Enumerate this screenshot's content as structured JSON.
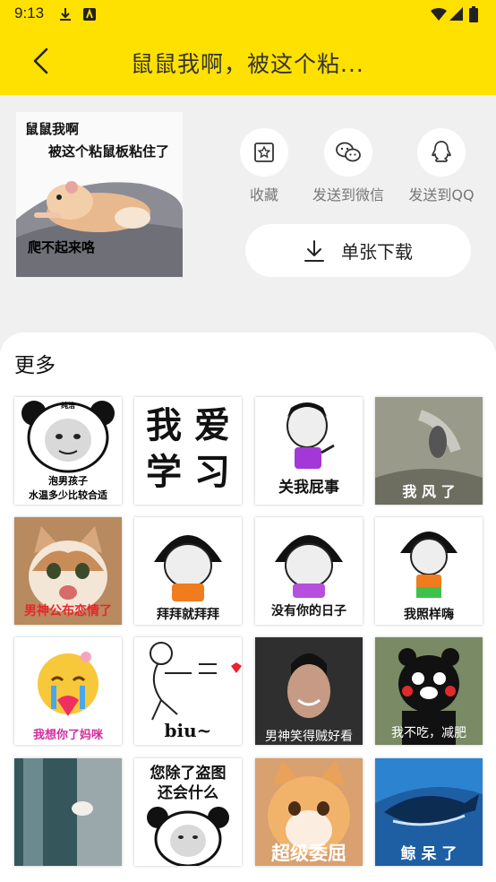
{
  "status": {
    "time": "9:13",
    "icons": [
      "download-icon",
      "app-notification-icon",
      "wifi-icon",
      "signal-icon",
      "battery-icon"
    ]
  },
  "appbar": {
    "title": "鼠鼠我啊，被这个粘...",
    "back_icon": "chevron-left-icon",
    "background_color": "#FFE100"
  },
  "preview": {
    "line1": "鼠鼠我啊",
    "line2": "被这个粘鼠板粘住了",
    "line3": "爬不起来咯"
  },
  "actions": [
    {
      "label": "收藏",
      "icon": "star-bookmark-icon"
    },
    {
      "label": "发送到微信",
      "icon": "wechat-icon"
    },
    {
      "label": "发送到QQ",
      "icon": "qq-icon"
    }
  ],
  "download": {
    "label": "单张下载",
    "icon": "download-icon"
  },
  "more": {
    "title": "更多",
    "tiles": [
      {
        "caption": "泡男孩子\n水温多少比较合适",
        "top_text": "纯洁"
      },
      {
        "caption": "我 爱\n学 习"
      },
      {
        "caption": "关我屁事"
      },
      {
        "caption": "我 风 了"
      },
      {
        "caption": "男神公布恋情了"
      },
      {
        "caption": "拜拜就拜拜"
      },
      {
        "caption": "没有你的日子"
      },
      {
        "caption": "我照样嗨"
      },
      {
        "caption": "我想你了妈咪"
      },
      {
        "caption": "biu~"
      },
      {
        "caption": "男神笑得贼好看"
      },
      {
        "caption": "我不吃，减肥"
      },
      {
        "caption": ""
      },
      {
        "caption": "您除了盗图\n还会什么"
      },
      {
        "caption": "超级委屈"
      },
      {
        "caption": "鲸 呆 了"
      }
    ]
  }
}
